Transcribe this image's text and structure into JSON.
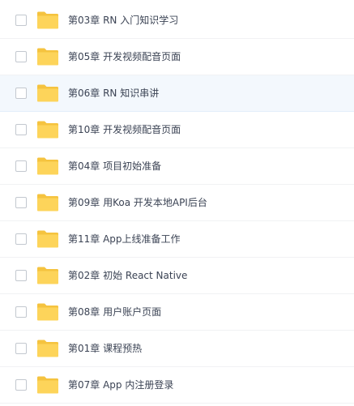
{
  "colors": {
    "folder_back": "#f5c33f",
    "folder_front": "#fdd45a",
    "selected_row_bg": "#f3f8fd",
    "text": "#3b4354"
  },
  "items": [
    {
      "name": "第03章 RN 入门知识学习",
      "icon": "folder-icon",
      "selected": false
    },
    {
      "name": "第05章 开发视频配音页面",
      "icon": "folder-icon",
      "selected": false
    },
    {
      "name": "第06章 RN 知识串讲",
      "icon": "folder-icon",
      "selected": true
    },
    {
      "name": "第10章 开发视频配音页面",
      "icon": "folder-icon",
      "selected": false
    },
    {
      "name": "第04章 项目初始准备",
      "icon": "folder-icon",
      "selected": false
    },
    {
      "name": "第09章 用Koa 开发本地API后台",
      "icon": "folder-icon",
      "selected": false
    },
    {
      "name": "第11章 App上线准备工作",
      "icon": "folder-icon",
      "selected": false
    },
    {
      "name": "第02章 初始 React Native",
      "icon": "folder-icon",
      "selected": false
    },
    {
      "name": "第08章 用户账户页面",
      "icon": "folder-icon",
      "selected": false
    },
    {
      "name": "第01章 课程预热",
      "icon": "folder-icon",
      "selected": false
    },
    {
      "name": "第07章 App 内注册登录",
      "icon": "folder-icon",
      "selected": false
    }
  ]
}
